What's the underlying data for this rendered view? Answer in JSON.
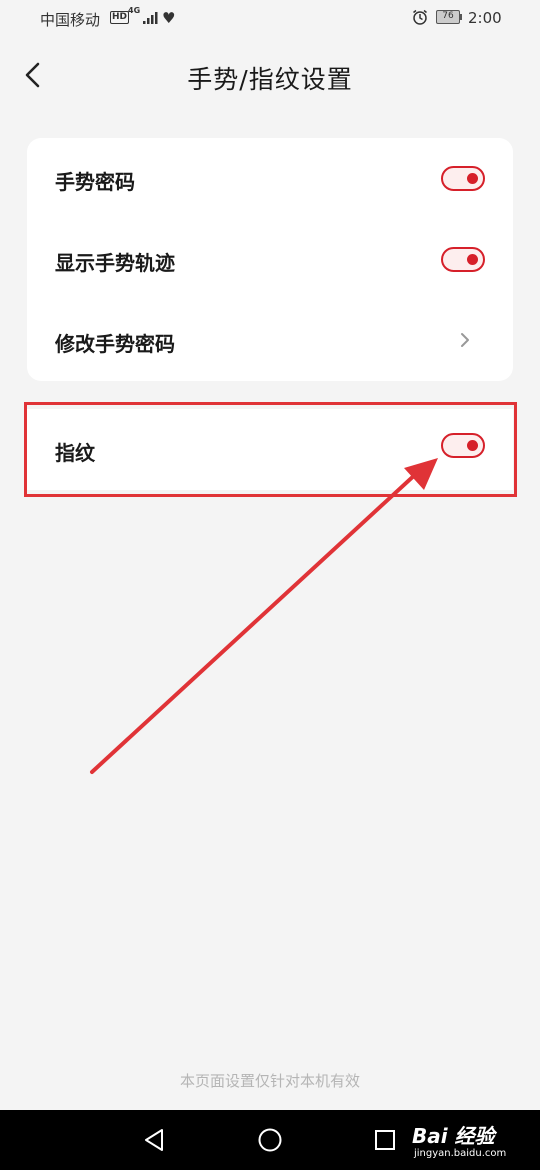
{
  "status_bar": {
    "carrier": "中国移动",
    "hd_badge": "HD",
    "network": "4G",
    "battery_level": "76",
    "time": "2:00",
    "icons": [
      "signal-icon",
      "heart-icon",
      "alarm-icon",
      "battery-icon"
    ]
  },
  "header": {
    "title": "手势/指纹设置",
    "back_icon": "chevron-left-icon"
  },
  "settings": {
    "gesture_password": {
      "label": "手势密码",
      "enabled": true
    },
    "show_gesture_track": {
      "label": "显示手势轨迹",
      "enabled": true
    },
    "change_gesture_password": {
      "label": "修改手势密码",
      "icon": "chevron-right-icon"
    },
    "fingerprint": {
      "label": "指纹",
      "enabled": true
    }
  },
  "footer": {
    "note": "本页面设置仅针对本机有效"
  },
  "nav_bar": {
    "buttons": [
      "back-triangle-icon",
      "home-circle-icon",
      "recents-square-icon"
    ]
  },
  "watermark": {
    "brand": "Bai 经验",
    "url": "jingyan.baidu.com"
  },
  "colors": {
    "accent": "#d6202a",
    "annotation": "#e03337",
    "background": "#f4f4f4"
  }
}
